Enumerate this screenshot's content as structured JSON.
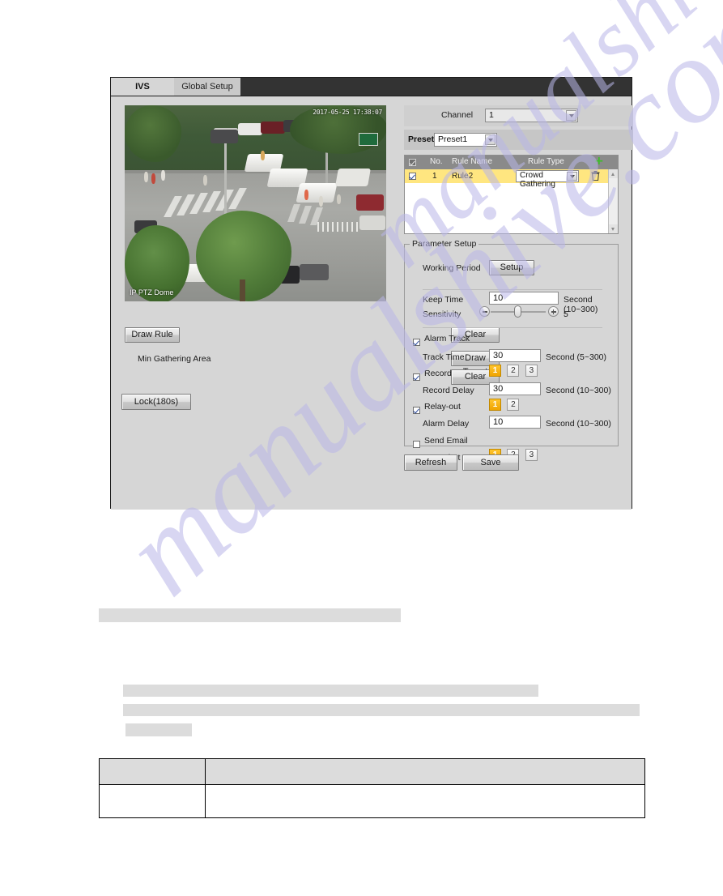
{
  "window": {
    "tabs": [
      {
        "label": "IVS",
        "active": true
      },
      {
        "label": "Global Setup",
        "active": false
      }
    ]
  },
  "video": {
    "timestamp": "2017-05-25 17:38:07",
    "camera_name": "IP PTZ Dome"
  },
  "left_controls": {
    "draw_rule_label": "Draw Rule",
    "clear_rule_label": "Clear",
    "min_gathering_area_label": "Min Gathering Area",
    "draw_target_label": "Draw Target",
    "clear_target_label": "Clear",
    "lock_label": "Lock(180s)"
  },
  "channel": {
    "label": "Channel",
    "value": "1",
    "options": [
      "1"
    ]
  },
  "preset": {
    "label": "Preset",
    "value": "Preset1",
    "options": [
      "Preset1"
    ]
  },
  "rule_table": {
    "headers": {
      "no": "No.",
      "rule_name": "Rule Name",
      "rule_type": "Rule Type"
    },
    "add_icon": "plus-icon",
    "rows": [
      {
        "checked": true,
        "no": "1",
        "rule_name": "Rule2",
        "rule_type": "Crowd Gathering",
        "delete_icon": "trash-icon"
      }
    ]
  },
  "parameter_setup": {
    "legend": "Parameter Setup",
    "working_period": {
      "label": "Working Period",
      "button": "Setup"
    },
    "keep_time": {
      "label": "Keep Time",
      "value": "10",
      "unit": "Second (10~300)"
    },
    "sensitivity": {
      "label": "Sensitivity",
      "value": "5",
      "minus_icon": "minus-icon",
      "plus_icon": "plus-icon"
    },
    "alarm_track": {
      "label": "Alarm Track",
      "checked": true
    },
    "track_time": {
      "label": "Track Time",
      "value": "30",
      "unit": "Second (5~300)"
    },
    "record": {
      "label": "Record",
      "checked": true,
      "channels": [
        "1",
        "2",
        "3"
      ],
      "selected": [
        "1"
      ]
    },
    "record_delay": {
      "label": "Record Delay",
      "value": "30",
      "unit": "Second (10~300)"
    },
    "relay_out": {
      "label": "Relay-out",
      "checked": true,
      "channels": [
        "1",
        "2"
      ],
      "selected": [
        "1"
      ]
    },
    "alarm_delay": {
      "label": "Alarm Delay",
      "value": "10",
      "unit": "Second (10~300)"
    },
    "send_email": {
      "label": "Send Email",
      "checked": false
    },
    "snapshot": {
      "label": "Snapshot",
      "checked": true,
      "channels": [
        "1",
        "2",
        "3"
      ],
      "selected": [
        "1"
      ]
    }
  },
  "footer_buttons": {
    "refresh": "Refresh",
    "save": "Save"
  },
  "watermark": {
    "text": "manualshive.com"
  },
  "colors": {
    "accent_orange": "#f0a400",
    "row_highlight": "#ffe680",
    "header_gray": "#8a8a8a",
    "panel_bg": "#d6d6d6",
    "add_green": "#3cbf27",
    "watermark": "#b9b6e8"
  }
}
